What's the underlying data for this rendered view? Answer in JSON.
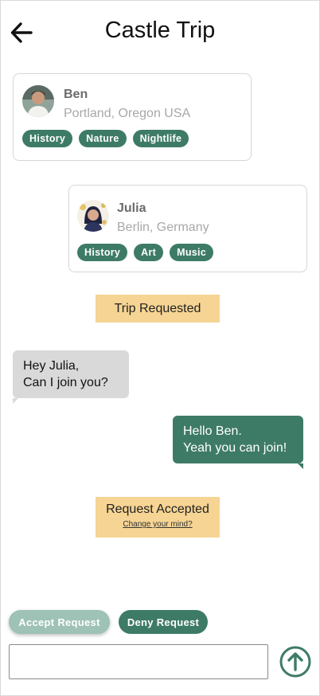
{
  "header": {
    "title": "Castle Trip",
    "back_icon": "arrow-left-icon"
  },
  "cards": {
    "ben": {
      "name": "Ben",
      "location": "Portland, Oregon USA",
      "tags": [
        "History",
        "Nature",
        "Nightlife"
      ]
    },
    "julia": {
      "name": "Julia",
      "location": "Berlin, Germany",
      "tags": [
        "History",
        "Art",
        "Music"
      ]
    }
  },
  "status": {
    "requested": "Trip Requested",
    "accepted": "Request Accepted",
    "change_mind": "Change your mind?"
  },
  "messages": {
    "incoming": [
      "Hey Julia,",
      "Can I join you?"
    ],
    "outgoing": [
      "Hello Ben.",
      "Yeah you can join!"
    ]
  },
  "actions": {
    "accept_label": "Accept Request",
    "deny_label": "Deny Request"
  },
  "composer": {
    "placeholder": "",
    "send_icon": "arrow-up-circle-icon"
  },
  "colors": {
    "accent": "#3e7b66",
    "accent_light": "#9ec2b5",
    "status_bg": "#f6d493",
    "incoming_bubble": "#d9d9d9"
  }
}
